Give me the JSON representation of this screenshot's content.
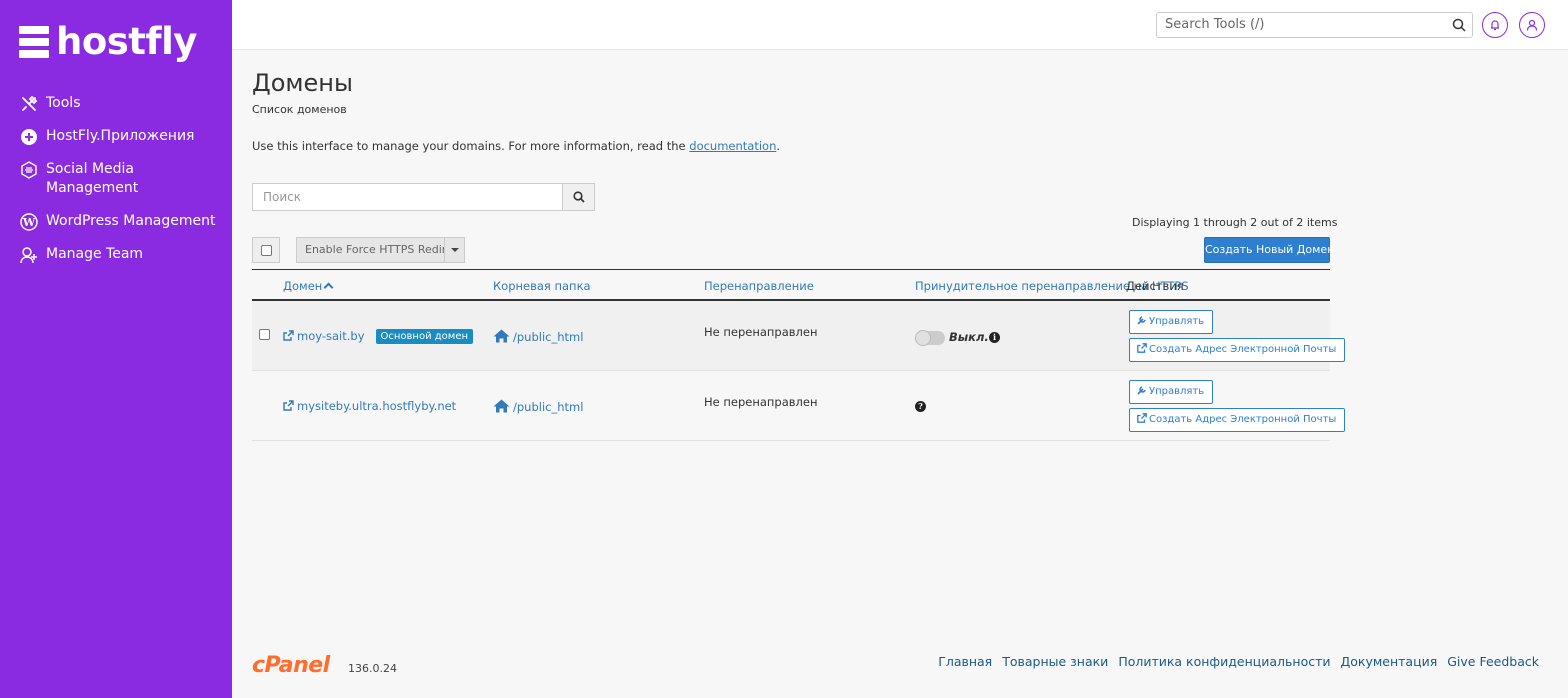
{
  "brand": {
    "name": "hostfly"
  },
  "sidebar": {
    "items": [
      {
        "label": "Tools",
        "icon": "tools-icon"
      },
      {
        "label": "HostFly.Приложения",
        "icon": "apps-icon"
      },
      {
        "label": "Social Media Management",
        "icon": "social-media-icon"
      },
      {
        "label": "WordPress Management",
        "icon": "wordpress-icon"
      },
      {
        "label": "Manage Team",
        "icon": "team-icon"
      }
    ]
  },
  "topbar": {
    "search_placeholder": "Search Tools (/)",
    "notifications_icon": "bell-icon",
    "user_icon": "user-icon"
  },
  "page": {
    "title": "Домены",
    "subtitle": "Список доменов",
    "intro_text": "Use this interface to manage your domains. For more information, read the ",
    "intro_link": "documentation",
    "intro_end": "."
  },
  "domain_search": {
    "placeholder": "Поиск"
  },
  "displaying": "Displaying 1 through 2 out of 2 items",
  "toolbar": {
    "force_https_label": "Enable Force HTTPS Redirect",
    "create_domain_label": "Создать Новый Домен"
  },
  "table": {
    "headers": {
      "domain": "Домен",
      "root": "Корневая папка",
      "redirect": "Перенаправление",
      "force_https": "Принудительное перенаправление на HTTPS",
      "actions": "Действия"
    },
    "rows": [
      {
        "domain": "moy-sait.by",
        "badge": "Основной домен",
        "root": "/public_html",
        "redirect": "Не перенаправлен",
        "https_state": "Выкл.",
        "manage": "Управлять",
        "create_email": "Создать Адрес Электронной Почты"
      },
      {
        "domain": "mysiteby.ultra.hostflyby.net",
        "root": "/public_html",
        "redirect": "Не перенаправлен",
        "manage": "Управлять",
        "create_email": "Создать Адрес Электронной Почты"
      }
    ]
  },
  "footer": {
    "logo": "cPanel",
    "version": "136.0.24",
    "links": [
      "Главная",
      "Товарные знаки",
      "Политика конфиденциальности",
      "Документация",
      "Give Feedback"
    ]
  },
  "colors": {
    "sidebar": "#8a2be2",
    "primary": "#2f7fd0",
    "link": "#337ab7",
    "cpanel": "#ff6c2c"
  }
}
